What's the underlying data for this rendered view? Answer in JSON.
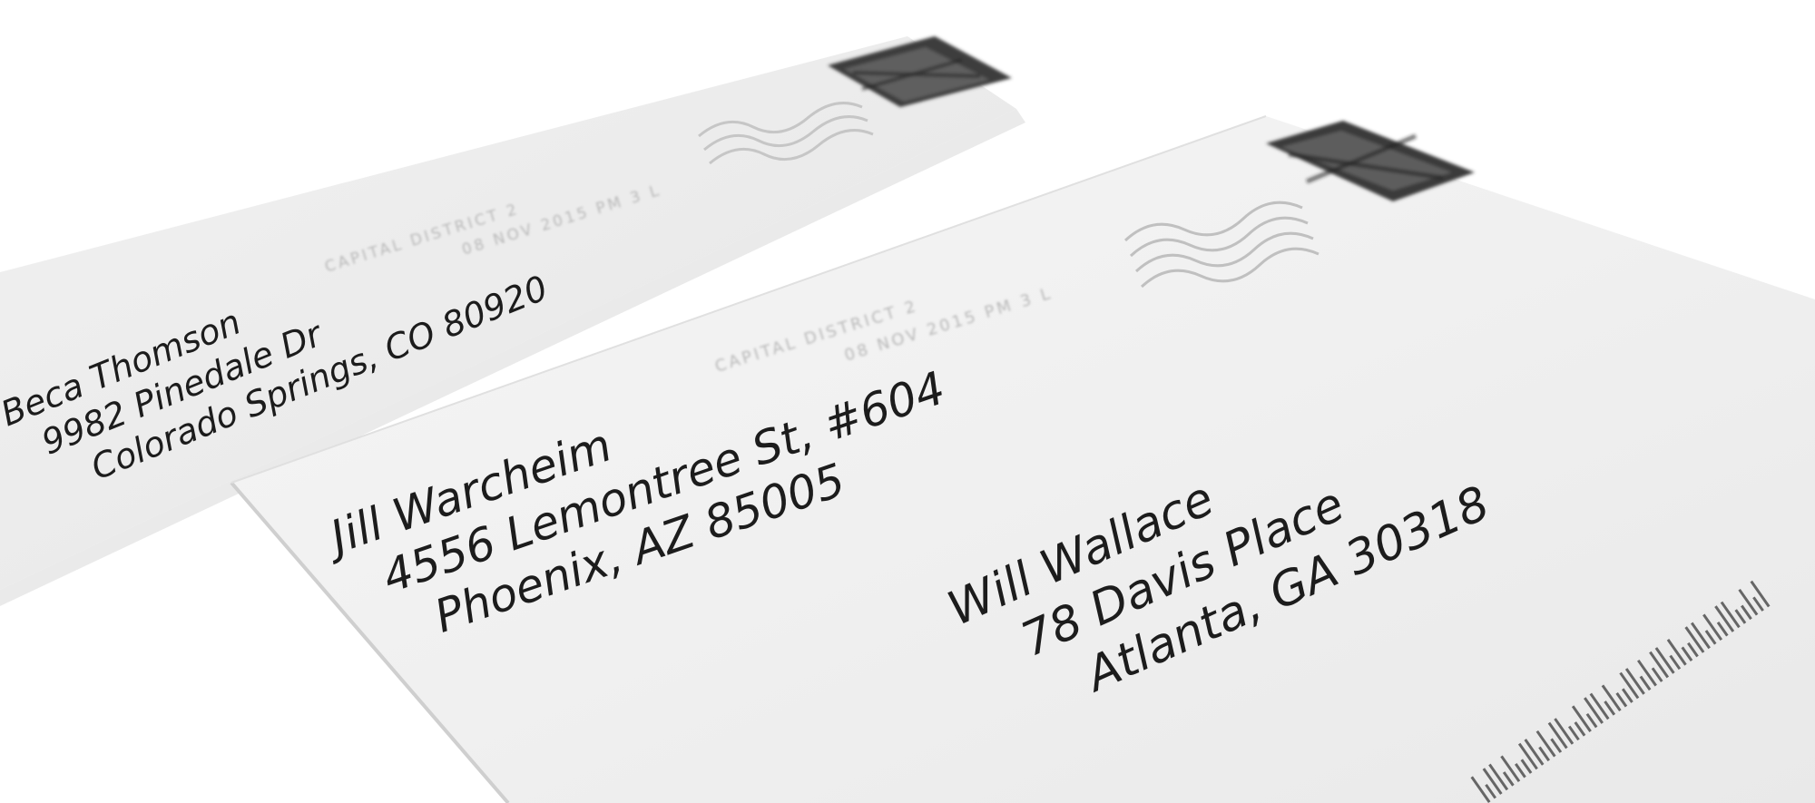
{
  "back_envelope": {
    "return_address": {
      "name": "Beca Thomson",
      "street": "9982 Pinedale Dr",
      "city_state_zip": "Colorado Springs, CO 80920"
    },
    "postmark_lines": [
      "CAPITAL DISTRICT 2",
      "08 NOV 2015 PM 3 L"
    ]
  },
  "front_envelope": {
    "return_address": {
      "name": "Jill Warcheim",
      "street": "4556 Lemontree St, #604",
      "city_state_zip": "Phoenix, AZ 85005"
    },
    "recipient": {
      "name": "Will Wallace",
      "street": "78 Davis Place",
      "city_state_zip": "Atlanta, GA 30318"
    },
    "postmark_lines": [
      "CAPITAL DISTRICT 2",
      "08 NOV 2015 PM 3 L"
    ]
  },
  "colors": {
    "background": "#ffffff",
    "paper": "#f3f3f3",
    "ink": "#1c1c1c",
    "stamp": "#3c3c3c"
  },
  "icons": [
    "postage-stamp-icon",
    "postmark-wave-icon",
    "postal-barcode-icon"
  ]
}
